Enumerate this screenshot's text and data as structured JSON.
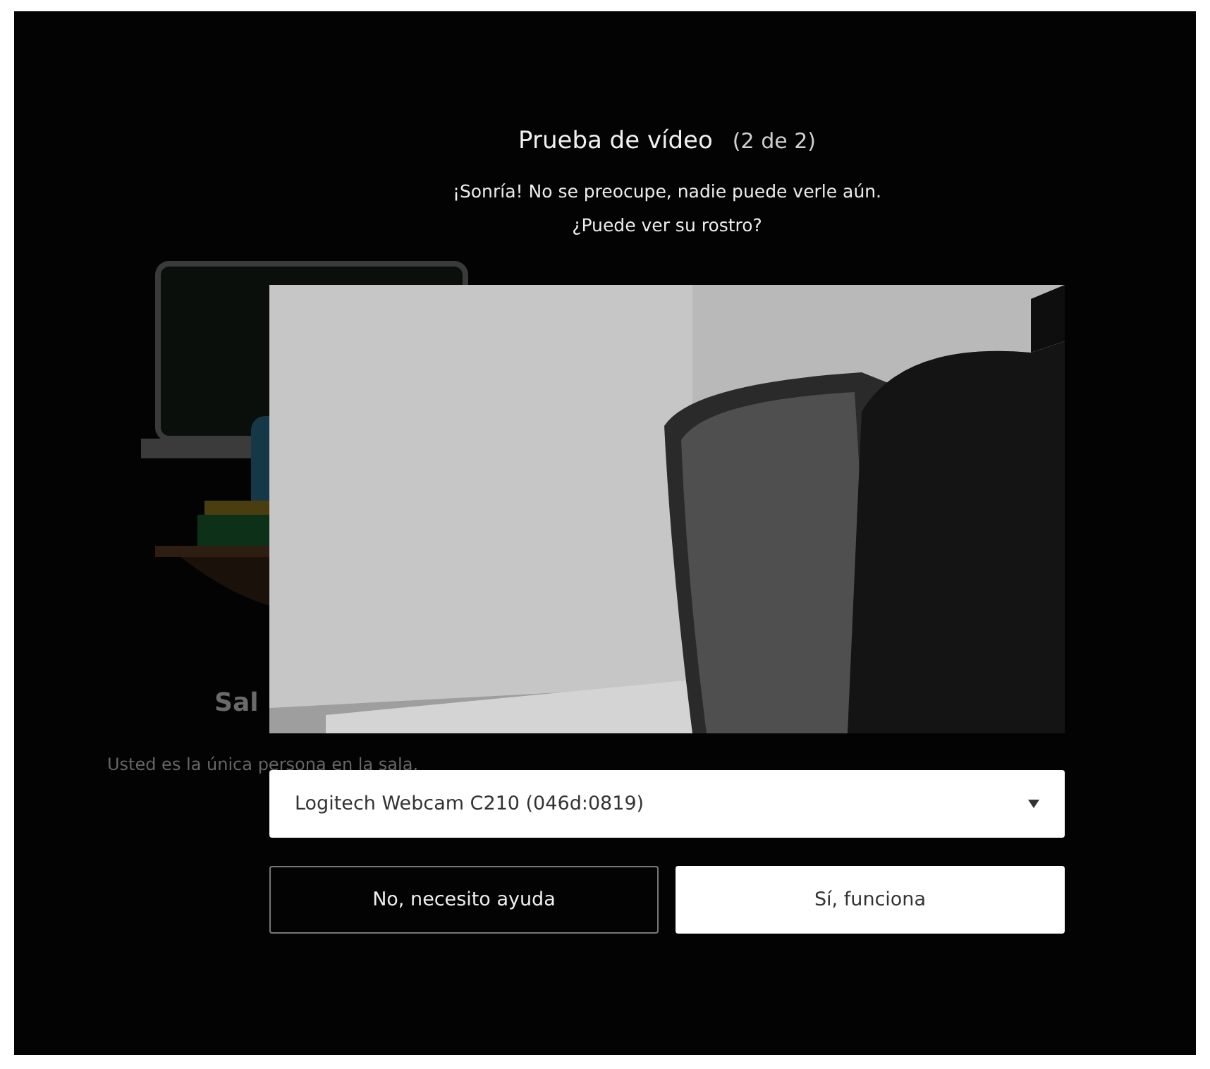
{
  "background": {
    "room_title": "Sal",
    "room_note": "Usted es la única persona en la sala."
  },
  "dialog": {
    "title": "Prueba de vídeo",
    "step": "(2 de 2)",
    "message": "¡Sonría! No se preocupe, nadie puede verle aún.",
    "question": "¿Puede ver su rostro?",
    "camera_select": {
      "value": "Logitech Webcam C210 (046d:0819)"
    },
    "buttons": [
      {
        "label": "No, necesito ayuda",
        "kind": "secondary"
      },
      {
        "label": "Sí, funciona",
        "kind": "primary"
      }
    ]
  }
}
